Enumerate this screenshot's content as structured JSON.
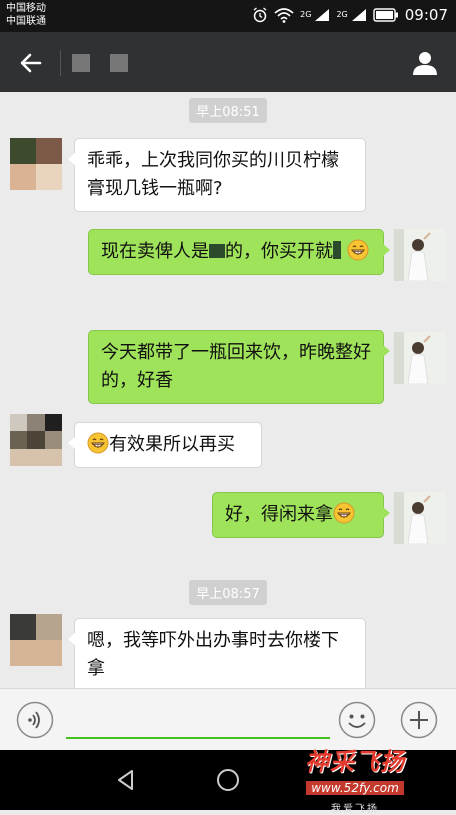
{
  "status_bar": {
    "carrier_1": "中国移动",
    "carrier_2": "中国联通",
    "network_1": "2G",
    "network_2": "2G",
    "time": "09:07",
    "icons": [
      "alarm-icon",
      "wifi-icon",
      "signal-icon",
      "signal-icon",
      "battery-icon"
    ]
  },
  "topbar": {
    "back_icon": "back-arrow-icon",
    "contact_icon": "person-icon"
  },
  "chat": {
    "timestamps": [
      "早上08:51",
      "早上08:57"
    ],
    "messages": [
      {
        "side": "left",
        "text": "乖乖，上次我同你买的川贝柠檬膏现几钱一瓶啊?"
      },
      {
        "side": "right",
        "text": "现在卖俾人是",
        "text_2": "的，你买开就"
      },
      {
        "side": "right",
        "text": "今天都带了一瓶回来饮，昨晚整好的，好香"
      },
      {
        "side": "left",
        "text": "有效果所以再买"
      },
      {
        "side": "right",
        "text": "好，得闲来拿"
      },
      {
        "side": "left",
        "text": "嗯，我等吓外出办事时去你楼下拿"
      }
    ],
    "emoji_icon": "grin-emoji-icon"
  },
  "input_bar": {
    "voice_icon": "voice-icon",
    "emoji_icon": "smiley-icon",
    "plus_icon": "plus-icon",
    "placeholder": ""
  },
  "watermark": {
    "title": "神采飞扬",
    "url": "www.52fy.com",
    "sub": "我爱飞扬"
  },
  "colors": {
    "sent_bubble": "#9fe35a",
    "received_bubble": "#ffffff",
    "topbar": "#2f3132",
    "accent": "#45c01a"
  }
}
